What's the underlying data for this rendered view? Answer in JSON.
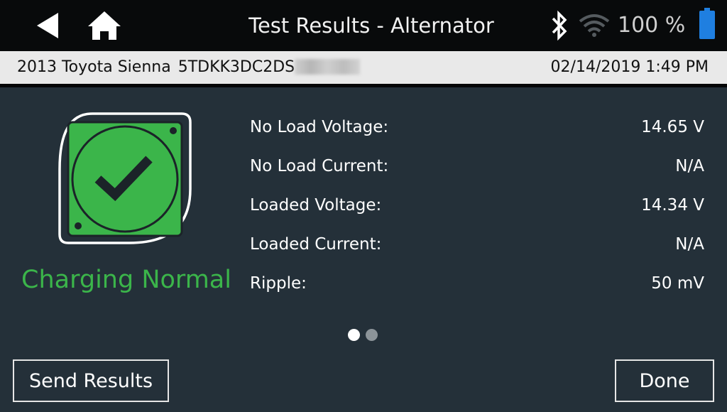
{
  "header": {
    "title": "Test Results - Alternator",
    "battery_percent": "100 %"
  },
  "vehicle": {
    "description": "2013 Toyota Sienna",
    "vin_visible": "5TDKK3DC2DS",
    "datetime": "02/14/2019 1:49 PM"
  },
  "result": {
    "status": "Charging Normal",
    "status_color": "#3bb54a"
  },
  "measurements": [
    {
      "label": "No Load Voltage:",
      "value": "14.65 V"
    },
    {
      "label": "No Load Current:",
      "value": "N/A"
    },
    {
      "label": "Loaded Voltage:",
      "value": "14.34 V"
    },
    {
      "label": "Loaded Current:",
      "value": "N/A"
    },
    {
      "label": "Ripple:",
      "value": "50 mV"
    }
  ],
  "pager": {
    "current_page": 1,
    "total_pages": 2
  },
  "buttons": {
    "send_results": "Send Results",
    "done": "Done"
  },
  "icons": {
    "back": "back-arrow-icon",
    "home": "home-icon",
    "bluetooth": "bluetooth-icon",
    "wifi": "wifi-icon",
    "battery": "battery-icon",
    "result": "check-circle-icon"
  },
  "colors": {
    "background": "#243039",
    "topbar": "#080a0b",
    "infobar": "#e9e9e9",
    "accent_green": "#3bb54a",
    "battery_blue": "#1f7fe0"
  }
}
